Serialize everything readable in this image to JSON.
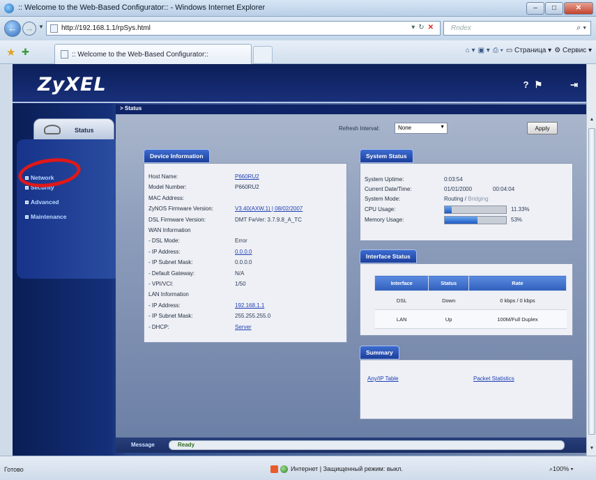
{
  "window": {
    "title": ":: Welcome to the Web-Based Configurator:: - Windows Internet Explorer"
  },
  "address": {
    "url": "http://192.168.1.1/rpSys.html",
    "search_placeholder": "Rndex"
  },
  "tabs": {
    "active_label": ":: Welcome to the Web-Based Configurator::",
    "commands": [
      "Страница",
      "Сервис"
    ]
  },
  "router": {
    "logo": "ZyXEL",
    "breadcrumb": "> Status",
    "menu_tab": "Status",
    "menu": [
      "Network",
      "Security",
      "Advanced",
      "Maintenance"
    ],
    "refresh_label": "Refresh Interval:",
    "refresh_value": "None",
    "apply_label": "Apply"
  },
  "device_info": {
    "heading": "Device Information",
    "rows": [
      {
        "k": "Host Name:",
        "v": "P660RU2",
        "link": true
      },
      {
        "k": "Model Number:",
        "v": "P660RU2",
        "link": false
      },
      {
        "k": "MAC Address:",
        "v": "",
        "link": false
      },
      {
        "k": "ZyNOS Firmware Version:",
        "v": "V3.40(AXW.1) | 08/02/2007",
        "link": true
      },
      {
        "k": "DSL Firmware Version:",
        "v": "DMT FwVer: 3.7.9.8_A_TC",
        "link": false
      },
      {
        "k": "WAN Information",
        "v": "",
        "link": false
      },
      {
        "k": "- DSL Mode:",
        "v": "Error",
        "link": false
      },
      {
        "k": "- IP Address:",
        "v": "0.0.0.0",
        "link": true
      },
      {
        "k": "- IP Subnet Mask:",
        "v": "0.0.0.0",
        "link": false
      },
      {
        "k": "- Default Gateway:",
        "v": "N/A",
        "link": false
      },
      {
        "k": "- VPI/VCI:",
        "v": "1/50",
        "link": false
      },
      {
        "k": "LAN Information",
        "v": "",
        "link": false
      },
      {
        "k": "- IP Address:",
        "v": "192.168.1.1",
        "link": true
      },
      {
        "k": "- IP Subnet Mask:",
        "v": "255.255.255.0",
        "link": false
      },
      {
        "k": "- DHCP:",
        "v": "Server",
        "link": true
      }
    ]
  },
  "system_status": {
    "heading": "System Status",
    "uptime_label": "System Uptime:",
    "uptime": "0:03:54",
    "date_label": "Current Date/Time:",
    "date": "01/01/2000",
    "time": "00:04:04",
    "mode_label": "System Mode:",
    "mode_routing": "Routing",
    "mode_sep": " / ",
    "mode_bridging": "Bridging",
    "cpu_label": "CPU Usage:",
    "cpu_pct": 11.33,
    "cpu_text": "11.33%",
    "mem_label": "Memory Usage:",
    "mem_pct": 53,
    "mem_text": "53%"
  },
  "interface_status": {
    "heading": "Interface Status",
    "columns": [
      "Interface",
      "Status",
      "Rate"
    ],
    "rows": [
      [
        "DSL",
        "Down",
        "0 kbps / 0 kbps"
      ],
      [
        "LAN",
        "Up",
        "100M/Full Duplex"
      ]
    ]
  },
  "summary": {
    "heading": "Summary",
    "link1": "Any/IP Table",
    "link2": "Packet Statistics"
  },
  "message": {
    "label": "Message",
    "text": "Ready"
  },
  "statusbar": {
    "left": "Готово",
    "zone": "Интернет | Защищенный режим: выкл.",
    "zoom": "100%"
  },
  "colors": {
    "highlight_circle": "#e11818",
    "panel_head": "#2a52b8",
    "link": "#1f3fb4"
  }
}
